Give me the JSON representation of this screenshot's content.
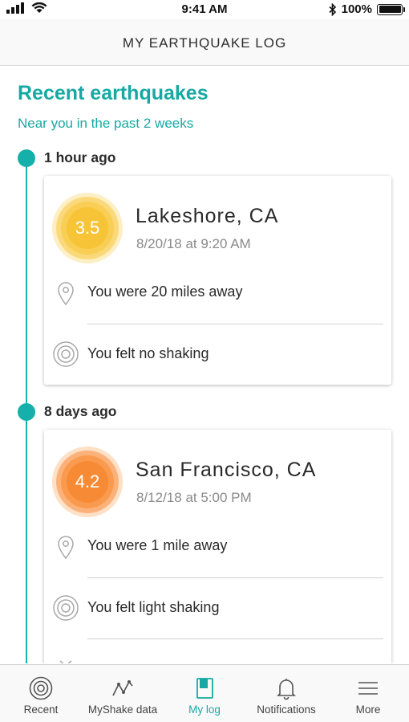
{
  "status_bar": {
    "time": "9:41 AM",
    "battery": "100%"
  },
  "header": {
    "title": "MY EARTHQUAKE LOG"
  },
  "section": {
    "title": "Recent earthquakes",
    "subtitle": "Near you in the past 2 weeks"
  },
  "entries": [
    {
      "when": "1 hour ago",
      "magnitude": "3.5",
      "place": "Lakeshore, CA",
      "date": "8/20/18 at 9:20 AM",
      "distance": "You were 20 miles away",
      "shaking": "You felt no shaking",
      "colors": {
        "outer": "#fdeec4",
        "ring": "#fbd97a",
        "mid": "#f8ce55",
        "core": "#f6c436"
      }
    },
    {
      "when": "8 days ago",
      "magnitude": "4.2",
      "place": "San Francisco, CA",
      "date": "8/12/18 at 5:00 PM",
      "distance": "You were 1 mile away",
      "shaking": "You felt light shaking",
      "colors": {
        "outer": "#fde0c6",
        "ring": "#fbb27a",
        "mid": "#f99a4f",
        "core": "#f78a34"
      }
    }
  ],
  "nav": [
    {
      "label": "Recent",
      "icon": "target-icon",
      "active": false
    },
    {
      "label": "MyShake data",
      "icon": "graph-icon",
      "active": false
    },
    {
      "label": "My log",
      "icon": "book-icon",
      "active": true
    },
    {
      "label": "Notifications",
      "icon": "bell-icon",
      "active": false
    },
    {
      "label": "More",
      "icon": "menu-icon",
      "active": false
    }
  ],
  "accent": "#16a9a3"
}
